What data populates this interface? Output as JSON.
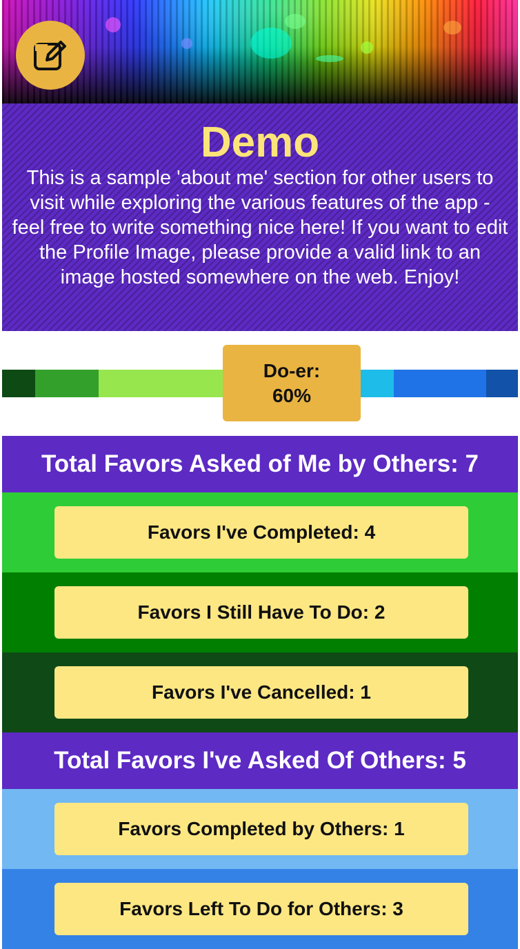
{
  "profile": {
    "name": "Demo",
    "bio": "This is a sample 'about me' section for other users to visit while exploring the various features of the app - feel free to write something nice here! If you want to edit the Profile Image, please provide a valid link to an image hosted somewhere on the web. Enjoy!"
  },
  "edit_button": {
    "icon": "edit-icon"
  },
  "doer_meter": {
    "label": "Do-er:",
    "percent_text": "60%",
    "value": 0.6,
    "segment_colors": [
      "#0e4a14",
      "#33a02b",
      "#97e64d",
      "#ffffff",
      "#1ebce9",
      "#1f73e6",
      "#1252a8"
    ]
  },
  "asked_of_me": {
    "header": "Total Favors Asked of Me by Others: 7",
    "items": [
      {
        "label": "Favors I've Completed: 4",
        "band_color": "#2ecc36"
      },
      {
        "label": "Favors I Still Have To Do: 2",
        "band_color": "#007f00"
      },
      {
        "label": "Favors I've Cancelled: 1",
        "band_color": "#0f4a16"
      }
    ]
  },
  "asked_of_others": {
    "header": "Total Favors I've Asked Of Others: 5",
    "items": [
      {
        "label": "Favors Completed by Others: 1",
        "band_color": "#72b8f3"
      },
      {
        "label": "Favors Left To Do for Others: 3",
        "band_color": "#3582e6"
      }
    ]
  },
  "colors": {
    "accent": "#e9b441",
    "purple": "#5d2ac4",
    "name_yellow": "#fde47a",
    "button_yellow": "#fde783"
  }
}
